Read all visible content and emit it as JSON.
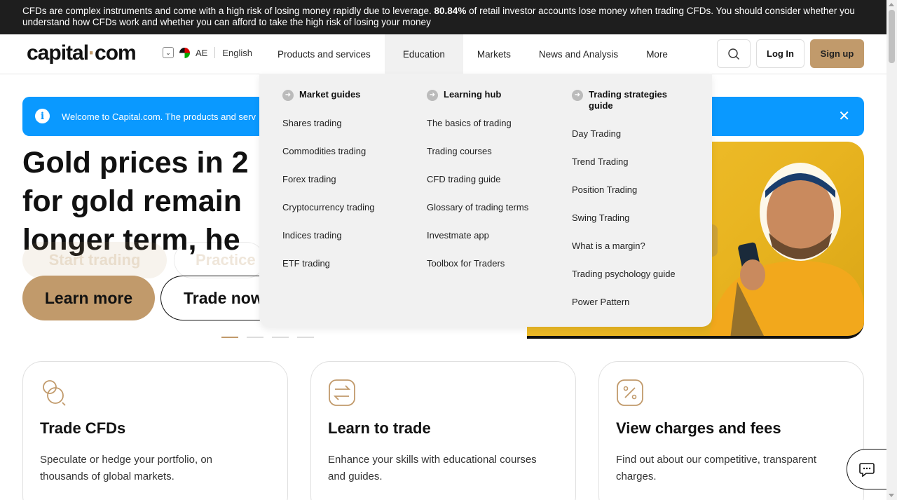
{
  "risk_banner": {
    "before": "CFDs are complex instruments and come with a high risk of losing money rapidly due to leverage. ",
    "percent": "80.84%",
    "after": " of retail investor accounts lose money when trading CFDs. You should consider whether you understand how CFDs work and whether you can afford to take the high risk of losing your money"
  },
  "header": {
    "logo_text_a": "capital",
    "logo_dot": "·",
    "logo_text_b": "com",
    "country_code": "AE",
    "language": "English",
    "nav": [
      "Products and services",
      "Education",
      "Markets",
      "News and Analysis",
      "More"
    ],
    "login_label": "Log In",
    "signup_label": "Sign up"
  },
  "info_bar": {
    "text": "Welcome to Capital.com. The products and serv"
  },
  "hero": {
    "title_lines": [
      "Gold prices in 2",
      "for gold remain",
      "longer term, he"
    ],
    "ghost_primary": "Start trading",
    "ghost_secondary": "Practice",
    "learn_more": "Learn more",
    "trade_now": "Trade now"
  },
  "education_menu": {
    "columns": [
      {
        "heading": "Market guides",
        "items": [
          "Shares trading",
          "Commodities trading",
          "Forex trading",
          "Cryptocurrency trading",
          "Indices trading",
          "ETF trading"
        ]
      },
      {
        "heading": "Learning hub",
        "items": [
          "The basics of trading",
          "Trading courses",
          "CFD trading guide",
          "Glossary of trading terms",
          "Investmate app",
          "Toolbox for Traders"
        ]
      },
      {
        "heading_line1": "Trading strategies",
        "heading_line2": "guide",
        "items": [
          "Day Trading",
          "Trend Trading",
          "Position Trading",
          "Swing Trading",
          "What is a margin?",
          "Trading psychology guide",
          "Power Pattern"
        ]
      }
    ]
  },
  "cards": [
    {
      "title": "Trade CFDs",
      "text": "Speculate or hedge your portfolio, on thousands of global markets."
    },
    {
      "title": "Learn to trade",
      "text": "Enhance your skills with educational courses and guides."
    },
    {
      "title": "View charges and fees",
      "text": "Find out about our competitive, transparent charges."
    }
  ],
  "colors": {
    "accent": "#c19a6b",
    "info_blue": "#0a99ff",
    "banner_bg": "#1e1e1e",
    "hero_yellow": "#f2c230"
  },
  "icons": [
    "info-icon",
    "close-icon",
    "search-icon",
    "chevron-down-icon",
    "arrow-right-icon",
    "chat-icon",
    "coins-icon",
    "exchange-icon",
    "percent-icon",
    "uae-flag-icon"
  ]
}
